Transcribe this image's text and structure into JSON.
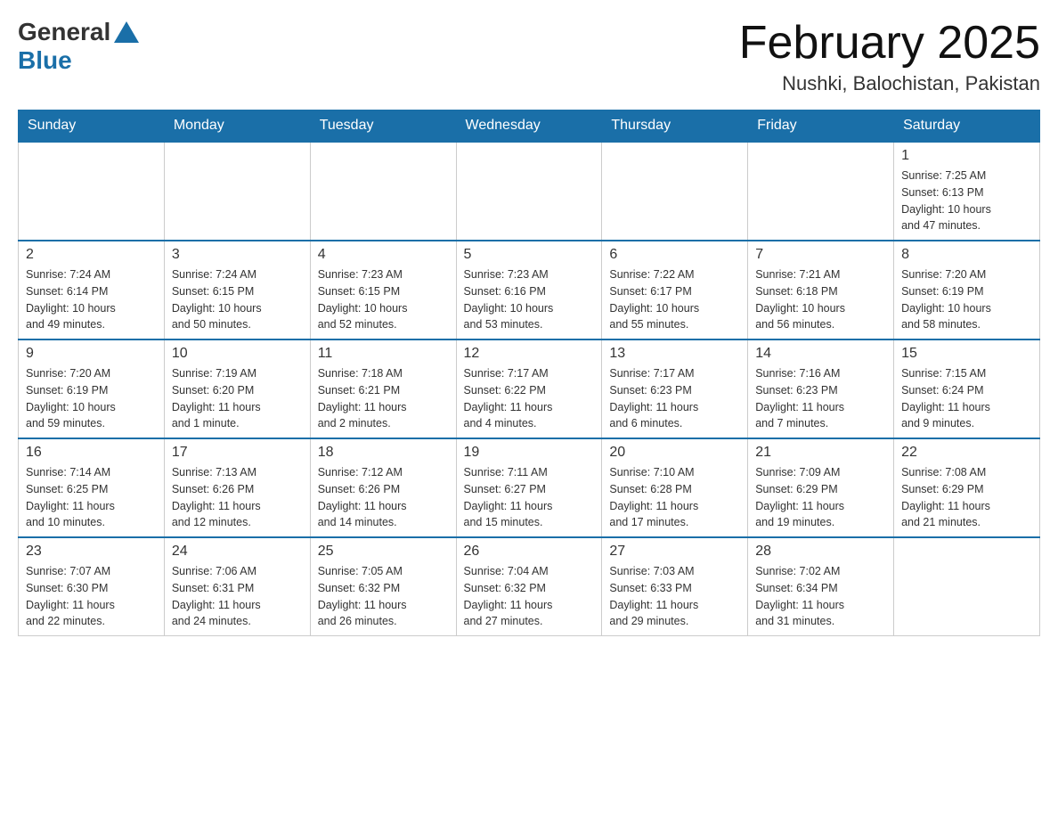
{
  "logo": {
    "general": "General",
    "blue": "Blue"
  },
  "title": {
    "month": "February 2025",
    "location": "Nushki, Balochistan, Pakistan"
  },
  "weekdays": [
    "Sunday",
    "Monday",
    "Tuesday",
    "Wednesday",
    "Thursday",
    "Friday",
    "Saturday"
  ],
  "weeks": [
    [
      {
        "day": "",
        "info": ""
      },
      {
        "day": "",
        "info": ""
      },
      {
        "day": "",
        "info": ""
      },
      {
        "day": "",
        "info": ""
      },
      {
        "day": "",
        "info": ""
      },
      {
        "day": "",
        "info": ""
      },
      {
        "day": "1",
        "info": "Sunrise: 7:25 AM\nSunset: 6:13 PM\nDaylight: 10 hours\nand 47 minutes."
      }
    ],
    [
      {
        "day": "2",
        "info": "Sunrise: 7:24 AM\nSunset: 6:14 PM\nDaylight: 10 hours\nand 49 minutes."
      },
      {
        "day": "3",
        "info": "Sunrise: 7:24 AM\nSunset: 6:15 PM\nDaylight: 10 hours\nand 50 minutes."
      },
      {
        "day": "4",
        "info": "Sunrise: 7:23 AM\nSunset: 6:15 PM\nDaylight: 10 hours\nand 52 minutes."
      },
      {
        "day": "5",
        "info": "Sunrise: 7:23 AM\nSunset: 6:16 PM\nDaylight: 10 hours\nand 53 minutes."
      },
      {
        "day": "6",
        "info": "Sunrise: 7:22 AM\nSunset: 6:17 PM\nDaylight: 10 hours\nand 55 minutes."
      },
      {
        "day": "7",
        "info": "Sunrise: 7:21 AM\nSunset: 6:18 PM\nDaylight: 10 hours\nand 56 minutes."
      },
      {
        "day": "8",
        "info": "Sunrise: 7:20 AM\nSunset: 6:19 PM\nDaylight: 10 hours\nand 58 minutes."
      }
    ],
    [
      {
        "day": "9",
        "info": "Sunrise: 7:20 AM\nSunset: 6:19 PM\nDaylight: 10 hours\nand 59 minutes."
      },
      {
        "day": "10",
        "info": "Sunrise: 7:19 AM\nSunset: 6:20 PM\nDaylight: 11 hours\nand 1 minute."
      },
      {
        "day": "11",
        "info": "Sunrise: 7:18 AM\nSunset: 6:21 PM\nDaylight: 11 hours\nand 2 minutes."
      },
      {
        "day": "12",
        "info": "Sunrise: 7:17 AM\nSunset: 6:22 PM\nDaylight: 11 hours\nand 4 minutes."
      },
      {
        "day": "13",
        "info": "Sunrise: 7:17 AM\nSunset: 6:23 PM\nDaylight: 11 hours\nand 6 minutes."
      },
      {
        "day": "14",
        "info": "Sunrise: 7:16 AM\nSunset: 6:23 PM\nDaylight: 11 hours\nand 7 minutes."
      },
      {
        "day": "15",
        "info": "Sunrise: 7:15 AM\nSunset: 6:24 PM\nDaylight: 11 hours\nand 9 minutes."
      }
    ],
    [
      {
        "day": "16",
        "info": "Sunrise: 7:14 AM\nSunset: 6:25 PM\nDaylight: 11 hours\nand 10 minutes."
      },
      {
        "day": "17",
        "info": "Sunrise: 7:13 AM\nSunset: 6:26 PM\nDaylight: 11 hours\nand 12 minutes."
      },
      {
        "day": "18",
        "info": "Sunrise: 7:12 AM\nSunset: 6:26 PM\nDaylight: 11 hours\nand 14 minutes."
      },
      {
        "day": "19",
        "info": "Sunrise: 7:11 AM\nSunset: 6:27 PM\nDaylight: 11 hours\nand 15 minutes."
      },
      {
        "day": "20",
        "info": "Sunrise: 7:10 AM\nSunset: 6:28 PM\nDaylight: 11 hours\nand 17 minutes."
      },
      {
        "day": "21",
        "info": "Sunrise: 7:09 AM\nSunset: 6:29 PM\nDaylight: 11 hours\nand 19 minutes."
      },
      {
        "day": "22",
        "info": "Sunrise: 7:08 AM\nSunset: 6:29 PM\nDaylight: 11 hours\nand 21 minutes."
      }
    ],
    [
      {
        "day": "23",
        "info": "Sunrise: 7:07 AM\nSunset: 6:30 PM\nDaylight: 11 hours\nand 22 minutes."
      },
      {
        "day": "24",
        "info": "Sunrise: 7:06 AM\nSunset: 6:31 PM\nDaylight: 11 hours\nand 24 minutes."
      },
      {
        "day": "25",
        "info": "Sunrise: 7:05 AM\nSunset: 6:32 PM\nDaylight: 11 hours\nand 26 minutes."
      },
      {
        "day": "26",
        "info": "Sunrise: 7:04 AM\nSunset: 6:32 PM\nDaylight: 11 hours\nand 27 minutes."
      },
      {
        "day": "27",
        "info": "Sunrise: 7:03 AM\nSunset: 6:33 PM\nDaylight: 11 hours\nand 29 minutes."
      },
      {
        "day": "28",
        "info": "Sunrise: 7:02 AM\nSunset: 6:34 PM\nDaylight: 11 hours\nand 31 minutes."
      },
      {
        "day": "",
        "info": ""
      }
    ]
  ]
}
